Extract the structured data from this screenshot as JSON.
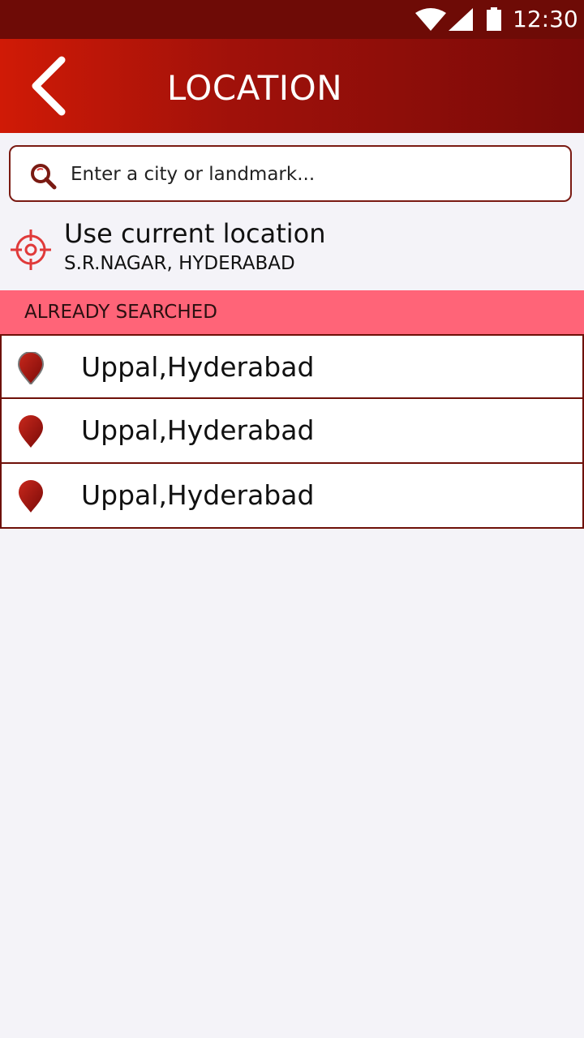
{
  "status_bar": {
    "time": "12:30"
  },
  "app_bar": {
    "title": "LOCATION"
  },
  "search": {
    "placeholder": "Enter a city or landmark..."
  },
  "current_location": {
    "label": "Use current location",
    "address": "S.R.NAGAR, HYDERABAD"
  },
  "history": {
    "header": "ALREADY SEARCHED",
    "items": [
      {
        "label": "Uppal,Hyderabad"
      },
      {
        "label": "Uppal,Hyderabad"
      },
      {
        "label": "Uppal,Hyderabad"
      }
    ]
  },
  "colors": {
    "status_bar": "#6e0b06",
    "app_bar_start": "#d01a06",
    "app_bar_end": "#7a0a08",
    "section_header": "#ff6478",
    "accent": "#e03a3a",
    "border": "#6e1008"
  }
}
